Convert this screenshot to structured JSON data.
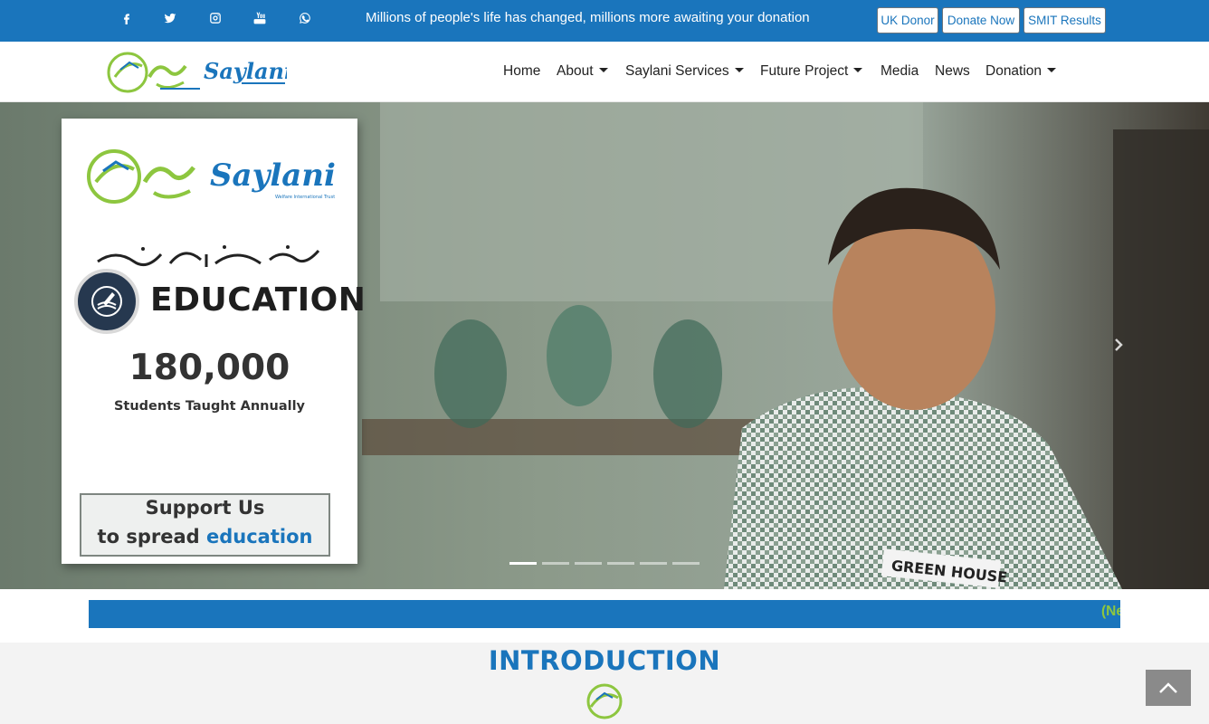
{
  "colors": {
    "brand_blue": "#1a75bc",
    "brand_green": "#8dc63f",
    "nav_text": "#222222"
  },
  "topbar": {
    "social_icons": [
      "facebook-icon",
      "twitter-icon",
      "instagram-icon",
      "youtube-icon",
      "whatsapp-icon"
    ],
    "tagline": "Millions of people's life has changed, millions more awaiting your donation",
    "buttons": {
      "uk_donor": "UK Donor",
      "donate_now": "Donate Now",
      "smit_results": "SMIT Results"
    }
  },
  "navbar": {
    "logo_text": "Saylani",
    "items": [
      {
        "label": "Home",
        "dropdown": false
      },
      {
        "label": "About",
        "dropdown": true
      },
      {
        "label": "Saylani Services",
        "dropdown": true
      },
      {
        "label": "Future Project",
        "dropdown": true
      },
      {
        "label": "Media",
        "dropdown": false
      },
      {
        "label": "News",
        "dropdown": false
      },
      {
        "label": "Donation",
        "dropdown": true
      }
    ]
  },
  "hero": {
    "promo": {
      "logo_text": "Saylani",
      "logo_subtext": "Welfare International Trust",
      "program": "EDUCATION",
      "stat_number": "180,000",
      "stat_caption": "Students Taught Annually",
      "support_line1": "Support Us",
      "support_line2_prefix": "to spread",
      "support_line2_accent": "education"
    },
    "photo_label": "GREEN HOUSE",
    "slide_count": 6,
    "active_slide": 1
  },
  "ticker": {
    "text": "(Ne"
  },
  "intro": {
    "title_part1": "INTRO",
    "title_part2": "DUCTION"
  }
}
